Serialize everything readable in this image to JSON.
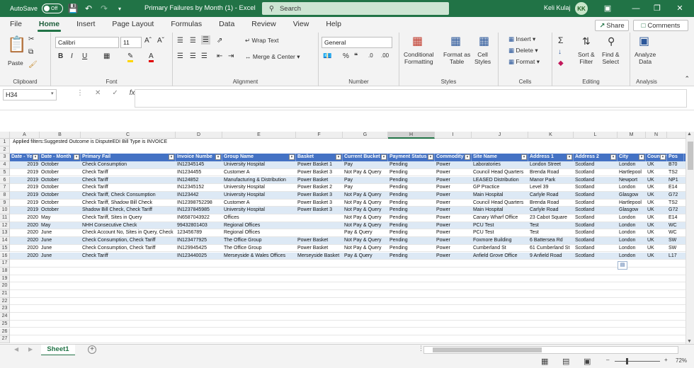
{
  "titlebar": {
    "autosave_label": "AutoSave",
    "autosave_state": "Off",
    "doc_title": "Primary Failures by Month (1)  -  Excel",
    "search_placeholder": "Search",
    "user_name": "Keli Kulaj",
    "user_initials": "KK"
  },
  "menu": {
    "tabs": [
      "File",
      "Home",
      "Insert",
      "Page Layout",
      "Formulas",
      "Data",
      "Review",
      "View",
      "Help"
    ],
    "active_tab": "Home",
    "share_label": "Share",
    "comments_label": "Comments"
  },
  "ribbon": {
    "clipboard": {
      "label": "Clipboard",
      "paste": "Paste"
    },
    "font": {
      "label": "Font",
      "font_name": "Calibri",
      "font_size": "11"
    },
    "alignment": {
      "label": "Alignment",
      "wrap_text": "Wrap Text",
      "merge_center": "Merge & Center"
    },
    "number": {
      "label": "Number",
      "format": "General"
    },
    "styles": {
      "label": "Styles",
      "conditional": "Conditional",
      "formatting": "Formatting",
      "format_as": "Format as",
      "table": "Table",
      "cell": "Cell",
      "styles": "Styles"
    },
    "cells": {
      "label": "Cells",
      "insert": "Insert",
      "delete": "Delete",
      "format": "Format"
    },
    "editing": {
      "label": "Editing",
      "sort": "Sort &",
      "filter": "Filter",
      "find": "Find &",
      "select": "Select"
    },
    "analysis": {
      "label": "Analysis",
      "analyze": "Analyze",
      "data": "Data"
    }
  },
  "formula_bar": {
    "name_box": "H34",
    "fx": "fx",
    "value": ""
  },
  "columns": [
    "A",
    "B",
    "C",
    "D",
    "E",
    "F",
    "G",
    "H",
    "I",
    "J",
    "K",
    "L",
    "M",
    "N"
  ],
  "selected_column": "H",
  "row1_text": "Applied filters:Suggested Outcome is DisputeEDI Bill Type is INVOICE",
  "headers": [
    "Date - Ye",
    "Date - Month",
    "Primary Fail",
    "Invoice Numbe",
    "Group Name",
    "Basket",
    "Current Bucket",
    "Payment Status",
    "Commodity",
    "Site Name",
    "Address 1",
    "Address 2",
    "City",
    "Country",
    "Pos"
  ],
  "rows": [
    [
      "2019",
      "October",
      "Check Consumption",
      "IN12345145",
      "University Hospital",
      "Power Basket 1",
      "Pay",
      "Pending",
      "Power",
      "Laboratories",
      "London Street",
      "Scotland",
      "London",
      "UK",
      "B70"
    ],
    [
      "2019",
      "October",
      "Check Tariff",
      "IN1234455",
      "Customer A",
      "Power Basket 3",
      "Not Pay & Query",
      "Pending",
      "Power",
      "Council Head Quarters",
      "Brenda Road",
      "Scotland",
      "Hartlepool",
      "UK",
      "TS2"
    ],
    [
      "2019",
      "October",
      "Check Tariff",
      "IN124852",
      "Manufacturing & Distribution",
      "Power Basket",
      "Pay",
      "Pending",
      "Power",
      "LEASED  Distribution",
      "Manor Park",
      "Scotland",
      "Newport",
      "UK",
      "NP1"
    ],
    [
      "2019",
      "October",
      "Check Tariff",
      "IN12345152",
      "University Hospital",
      "Power Basket 2",
      "Pay",
      "Pending",
      "Power",
      "GP Practice",
      "Level 39",
      "Scotland",
      "London",
      "UK",
      "E14"
    ],
    [
      "2019",
      "October",
      "Check Tariff, Check Consumption",
      "IN123442",
      "University Hospital",
      "Power Basket 3",
      "Not Pay & Query",
      "Pending",
      "Power",
      "Main Hospital",
      "Carlyle Road",
      "Scotland",
      "Glasgow",
      "UK",
      "G72"
    ],
    [
      "2019",
      "October",
      "Check Tariff, Shadow Bill Check",
      "IN12398752298",
      "Customer A",
      "Power Basket 3",
      "Not Pay & Query",
      "Pending",
      "Power",
      "Council Head Quarters",
      "Brenda Road",
      "Scotland",
      "Hartlepool",
      "UK",
      "TS2"
    ],
    [
      "2019",
      "October",
      "Shadow Bill Check, Check Tariff",
      "IN1237845985",
      "University Hospital",
      "Power Basket 3",
      "Not Pay & Query",
      "Pending",
      "Power",
      "Main Hospital",
      "Carlyle Road",
      "Scotland",
      "Glasgow",
      "UK",
      "G72"
    ],
    [
      "2020",
      "May",
      "Check Tariff, Sites in Query",
      "IN6587043922",
      "Offices",
      "",
      "Not Pay & Query",
      "Pending",
      "Power",
      "Canary Wharf Office",
      "23 Cabot Square",
      "Scotland",
      "London",
      "UK",
      "E14"
    ],
    [
      "2020",
      "May",
      "NHH Consecutive Check",
      "99432801403",
      "Regional Offices",
      "",
      "Not Pay & Query",
      "Pending",
      "Power",
      "PCU Test",
      "Test",
      "Scotland",
      "London",
      "UK",
      "WC"
    ],
    [
      "2020",
      "June",
      "Check Account No, Sites in Query, Check",
      "123456789",
      "Regional Offices",
      "",
      "Pay & Query",
      "Pending",
      "Power",
      "PCU Test",
      "Test",
      "Scotland",
      "London",
      "UK",
      "WC"
    ],
    [
      "2020",
      "June",
      "Check Consumption, Check Tariff",
      "IN123477925",
      "The Office Group",
      "Power Basket",
      "Not Pay & Query",
      "Pending",
      "Power",
      "Foxmore Building",
      "6 Battersea Rd",
      "Scotland",
      "London",
      "UK",
      "SW"
    ],
    [
      "2020",
      "June",
      "Check Consumption, Check Tariff",
      "IN129945425",
      "The Office Group",
      "Power Basket",
      "Not Pay & Query",
      "Pending",
      "Power",
      "Cumberland St",
      "61 Cumberland St",
      "Scotland",
      "London",
      "UK",
      "SW"
    ],
    [
      "2020",
      "June",
      "Check Tariff",
      "IN123440025",
      "Merseyside & Wales Offices",
      "Merseyside Basket",
      "Pay & Query",
      "Pending",
      "Power",
      "Anfield Grove Office",
      "9 Anfield Road",
      "Scotland",
      "London",
      "UK",
      "L17"
    ]
  ],
  "row_numbers": [
    "1",
    "2",
    "3",
    "4",
    "5",
    "6",
    "7",
    "8",
    "9",
    "10",
    "11",
    "12",
    "13",
    "14",
    "15",
    "16",
    "17",
    "18",
    "19",
    "20",
    "21",
    "22",
    "23",
    "24",
    "25",
    "26",
    "27"
  ],
  "sheet_tab": "Sheet1",
  "zoom": "72%"
}
